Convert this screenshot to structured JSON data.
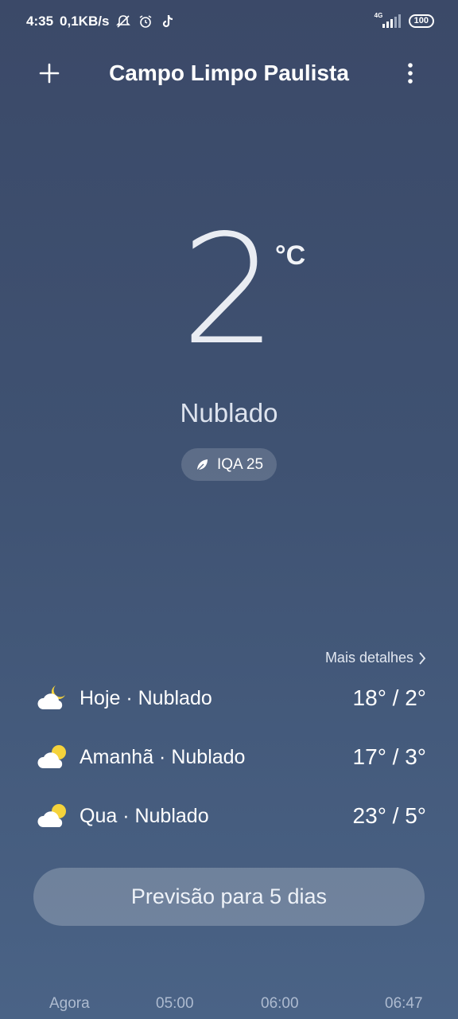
{
  "status_bar": {
    "time": "4:35",
    "net_speed": "0,1KB/s",
    "network": "4G",
    "battery": "100"
  },
  "header": {
    "title": "Campo Limpo Paulista"
  },
  "current": {
    "temperature": "2",
    "unit": "°C",
    "condition": "Nublado",
    "aqi_label": "IQA 25"
  },
  "details_link": "Mais detalhes",
  "forecast": [
    {
      "label": "Hoje · Nublado",
      "temps": "18° / 2°",
      "icon": "moon-cloud-icon"
    },
    {
      "label": "Amanhã · Nublado",
      "temps": "17° / 3°",
      "icon": "sun-cloud-icon"
    },
    {
      "label": "Qua · Nublado",
      "temps": "23° / 5°",
      "icon": "sun-cloud-icon"
    }
  ],
  "five_day_button": "Previsão para 5 dias",
  "hourly": [
    "Agora",
    "05:00",
    "06:00",
    "06:47"
  ],
  "colors": {
    "background_top": "#3b4968",
    "background_bottom": "#4a6386",
    "sun": "#f5d33b",
    "cloud": "#ffffff"
  }
}
